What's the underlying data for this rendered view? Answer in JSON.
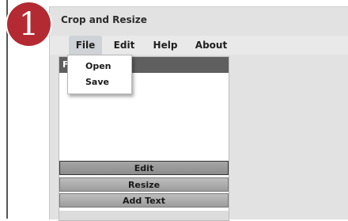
{
  "step_badge": {
    "number": "1"
  },
  "window": {
    "title": "Crop and Resize"
  },
  "menu": {
    "items": [
      {
        "label": "File"
      },
      {
        "label": "Edit"
      },
      {
        "label": "Help"
      },
      {
        "label": "About"
      }
    ],
    "open_menu": "File"
  },
  "file_menu": {
    "items": [
      {
        "label": "Open"
      },
      {
        "label": "Save"
      }
    ]
  },
  "panel": {
    "header_label": "F",
    "buttons": [
      {
        "label": "Edit",
        "selected": true
      },
      {
        "label": "Resize",
        "selected": false
      },
      {
        "label": "Add Text",
        "selected": false
      }
    ]
  },
  "colors": {
    "badge": "#b32a33",
    "panel_header": "#5f5f5f",
    "window_bg": "#e2e2e2"
  }
}
